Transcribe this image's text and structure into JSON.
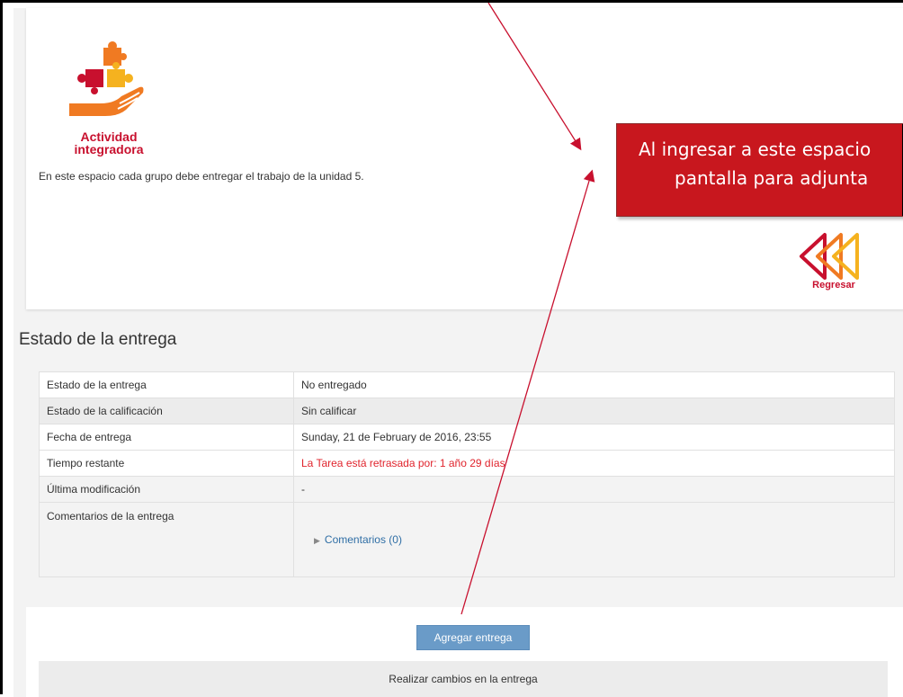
{
  "intro": {
    "logo_text": "Actividad integradora",
    "description": "En este espacio cada grupo debe entregar el trabajo de la unidad 5.",
    "back_label": "Regresar"
  },
  "callout": {
    "line1": "Al ingresar a este espacio",
    "line2": "pantalla para adjunta"
  },
  "status": {
    "title": "Estado de la entrega",
    "rows": [
      {
        "label": "Estado de la entrega",
        "value": "No entregado"
      },
      {
        "label": "Estado de la calificación",
        "value": "Sin calificar"
      },
      {
        "label": "Fecha de entrega",
        "value": "Sunday, 21 de February de 2016, 23:55"
      },
      {
        "label": "Tiempo restante",
        "value": "La Tarea está retrasada por: 1 año 29 días"
      },
      {
        "label": "Última modificación",
        "value": "-"
      },
      {
        "label": "Comentarios de la entrega",
        "value": "Comentarios (0)"
      }
    ]
  },
  "actions": {
    "add_label": "Agregar entrega",
    "changes_label": "Realizar cambios en la entrega"
  },
  "colors": {
    "brand_red": "#c8102e",
    "callout_red": "#c8171e",
    "button_blue": "#6a9bc8",
    "overdue_red": "#e0242d",
    "link_blue": "#2f6ea5"
  },
  "icons": [
    "puzzle-hand-logo-icon",
    "rewind-back-icon",
    "triangle-right-icon"
  ]
}
